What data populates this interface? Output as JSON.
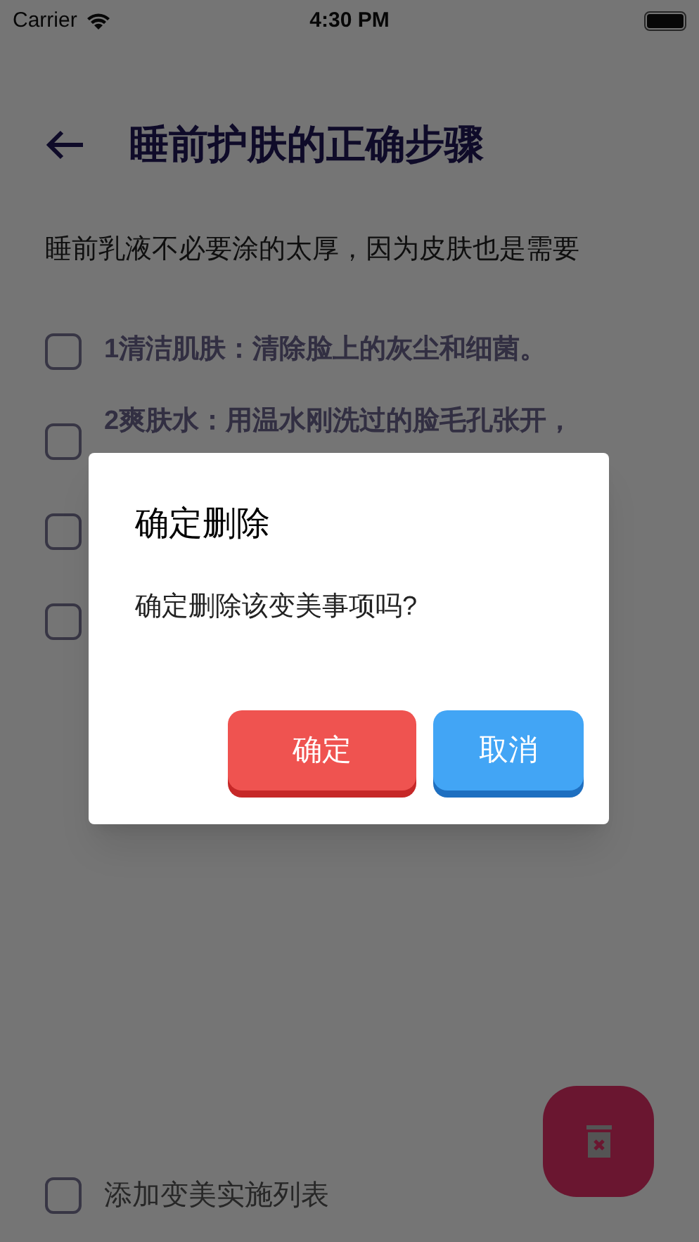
{
  "status_bar": {
    "carrier": "Carrier",
    "time": "4:30 PM"
  },
  "header": {
    "title": "睡前护肤的正确步骤"
  },
  "intro": "睡前乳液不必要涂的太厚，因为皮肤也是需要",
  "steps": [
    {
      "text": "1清洁肌肤：清除脸上的灰尘和细菌。",
      "checked": false
    },
    {
      "text": "2爽肤水：用温水刚洗过的脸毛孔张开，",
      "checked": false
    },
    {
      "checked": false
    },
    {
      "checked": false
    }
  ],
  "add_to_list": {
    "label": "添加变美实施列表",
    "checked": false
  },
  "dialog": {
    "title": "确定删除",
    "message": "确定删除该变美事项吗?",
    "buttons": [
      {
        "label": "确定",
        "kind": "confirm"
      },
      {
        "label": "取消",
        "kind": "cancel"
      }
    ]
  }
}
